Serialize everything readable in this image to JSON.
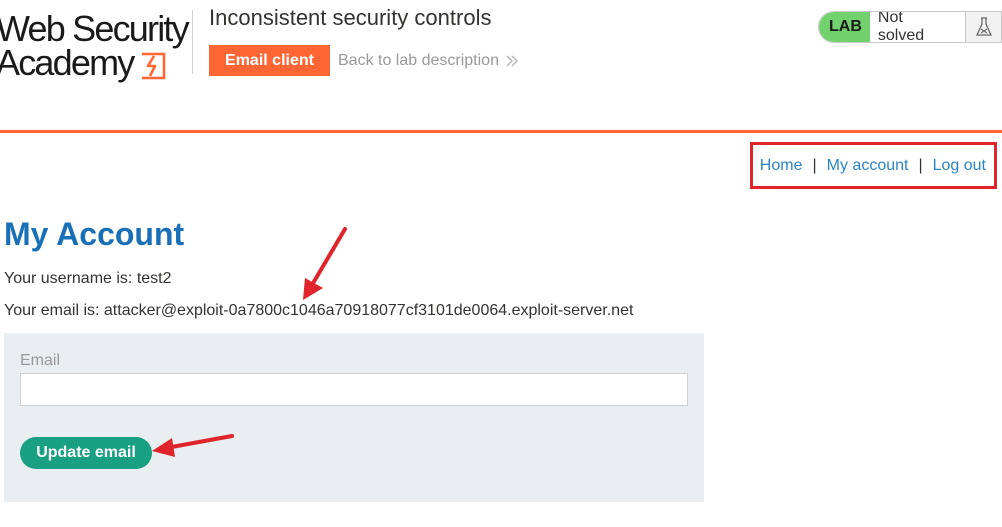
{
  "header": {
    "logo_line1": "Web Security",
    "logo_line2": "Academy",
    "lab_title": "Inconsistent security controls",
    "email_client_label": "Email client",
    "back_link_label": "Back to lab description",
    "lab_badge": "LAB",
    "lab_status": "Not solved",
    "accent_color": "#ff6633",
    "badge_color": "#70d16d",
    "icons": [
      "logo-lightning-icon",
      "double-chevron-right-icon",
      "flask-icon"
    ]
  },
  "nav": {
    "home": "Home",
    "my_account": "My account",
    "log_out": "Log out",
    "separator": "|",
    "highlight_color": "#e0242b"
  },
  "main": {
    "title": "My Account",
    "username_line": "Your username is: test2",
    "email_line": "Your email is: attacker@exploit-0a7800c1046a70918077cf3101de0064.exploit-server.net",
    "form": {
      "email_label": "Email",
      "email_value": "",
      "email_placeholder": "",
      "submit_label": "Update email"
    },
    "title_color": "#1a70b8",
    "button_color": "#199f82"
  },
  "annotations": {
    "arrow_color": "#e0242b",
    "arrows": [
      "arrow-to-email-line",
      "arrow-to-update-button"
    ]
  }
}
